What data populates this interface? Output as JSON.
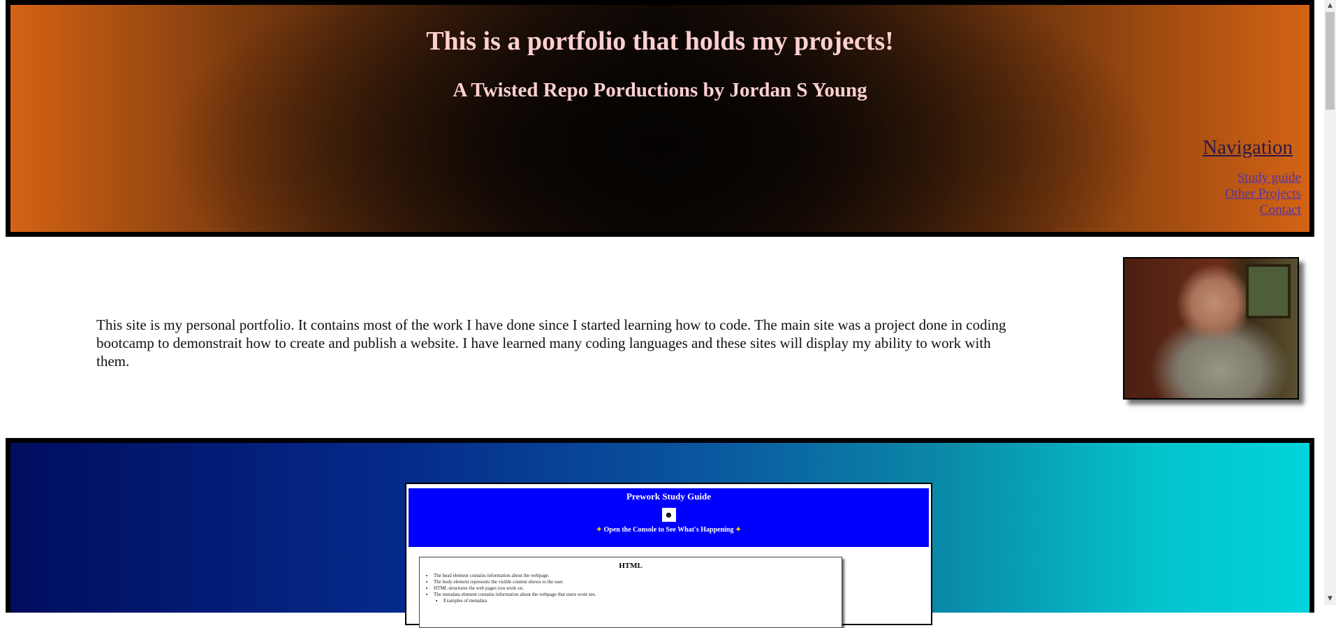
{
  "header": {
    "title": "This is a portfolio that holds my projects!",
    "subtitle": "A Twisted Repo Porductions by Jordan S Young",
    "nav_title": "Navigation",
    "nav_links": [
      "Study guide",
      "Other Projects",
      "Contact"
    ]
  },
  "about": {
    "text": "This site is my personal portfolio. It contains most of the work I have done since I started learning how to code. The main site was a project done in coding bootcamp to demonstrait how to create and publish a website. I have learned many coding languages and these sites will display my ability to work with them."
  },
  "project_card": {
    "title": "Prework Study Guide",
    "subtitle": "Open the Console to See What's Happening",
    "section_title": "HTML",
    "items": [
      "The head element contains information about the webpage.",
      "The body element represents the visible content shown to the user.",
      "HTML structures the web pages you work on.",
      "The metadata element contains information about the webpage that users wont see.",
      "Examples of metadata"
    ]
  },
  "colors": {
    "header_edge": "#d46314",
    "header_title": "#ffd0d0",
    "projects_left": "#000d5e",
    "projects_right": "#00d4dc",
    "card_header": "#0000ff"
  }
}
